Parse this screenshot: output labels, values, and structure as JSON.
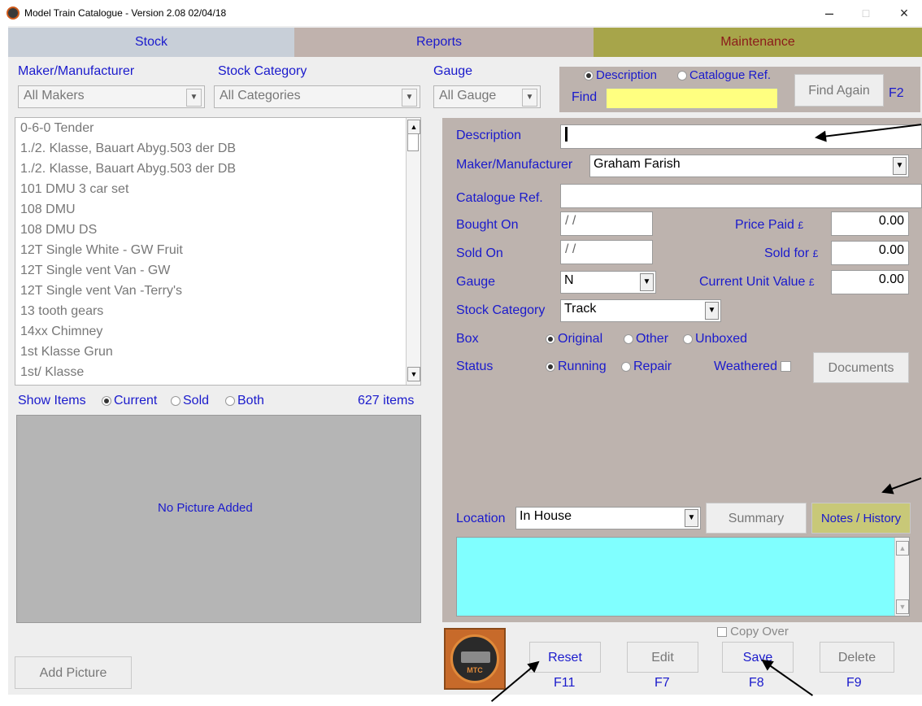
{
  "window": {
    "title": "Model Train Catalogue - Version 2.08  02/04/18",
    "minimize_glyph": "–",
    "maximize_glyph": "□",
    "close_glyph": "×"
  },
  "tabs": [
    {
      "label": "Stock",
      "color": "#c8cfd8",
      "text_color": "#1a1acc"
    },
    {
      "label": "Reports",
      "color": "#c0b2ad",
      "text_color": "#1a1acc"
    },
    {
      "label": "Maintenance",
      "color": "#a7a54a",
      "text_color": "#8b1a1a"
    }
  ],
  "filters": {
    "maker_label": "Maker/Manufacturer",
    "maker_value": "All Makers",
    "category_label": "Stock Category",
    "category_value": "All Categories",
    "gauge_label": "Gauge",
    "gauge_value": "All Gauge"
  },
  "find": {
    "option_description": "Description",
    "option_catalogue": "Catalogue Ref.",
    "selected": "Description",
    "label": "Find",
    "value": "",
    "find_again_label": "Find Again",
    "shortcut": "F2",
    "input_color": "#ffff80"
  },
  "stock_list": {
    "items": [
      "0-6-0 Tender",
      "1./2. Klasse, Bauart Abyg.503 der DB",
      "1./2. Klasse, Bauart Abyg.503 der DB",
      "101 DMU 3 car set",
      "108 DMU",
      "108 DMU DS",
      "12T Single White - GW Fruit",
      "12T Single vent Van - GW",
      "12T Single vent Van -Terry's",
      "13 tooth gears",
      "14xx Chimney",
      "1st Klasse Grun",
      "1st/ Klasse"
    ],
    "show_items_label": "Show Items",
    "show_options": [
      "Current",
      "Sold",
      "Both"
    ],
    "show_selected": "Current",
    "count_text": "627 items"
  },
  "picture": {
    "placeholder": "No Picture Added",
    "add_button": "Add Picture"
  },
  "details": {
    "panel_color": "#bdb3ae",
    "description_label": "Description",
    "description_value": "",
    "maker_label": "Maker/Manufacturer",
    "maker_value": "Graham Farish",
    "catalogue_label": "Catalogue Ref.",
    "catalogue_value": "",
    "bought_label": "Bought On",
    "bought_value": "/ /",
    "sold_label": "Sold On",
    "sold_value": "/ /",
    "gauge_label": "Gauge",
    "gauge_value": "N",
    "category_label": "Stock Category",
    "category_value": "Track",
    "price_paid_label": "Price Paid",
    "price_paid_value": "0.00",
    "sold_for_label": "Sold for",
    "sold_for_value": "0.00",
    "unit_value_label": "Current Unit Value",
    "unit_value_value": "0.00",
    "currency": "£",
    "box_label": "Box",
    "box_options": [
      "Original",
      "Other",
      "Unboxed"
    ],
    "box_selected": "Original",
    "status_label": "Status",
    "status_options": [
      "Running",
      "Repair"
    ],
    "status_selected": "Running",
    "weathered_label": "Weathered",
    "weathered_checked": false,
    "documents_button": "Documents",
    "location_label": "Location",
    "location_value": "In House",
    "summary_button": "Summary",
    "notes_button": "Notes / History",
    "notes_color": "#80ffff"
  },
  "actions": {
    "copy_over_label": "Copy Over",
    "copy_over_checked": false,
    "logo_text": "MTC",
    "buttons": [
      {
        "label": "Reset",
        "key": "F11",
        "enabled": true
      },
      {
        "label": "Edit",
        "key": "F7",
        "enabled": false
      },
      {
        "label": "Save",
        "key": "F8",
        "enabled": true
      },
      {
        "label": "Delete",
        "key": "F9",
        "enabled": false
      }
    ]
  }
}
